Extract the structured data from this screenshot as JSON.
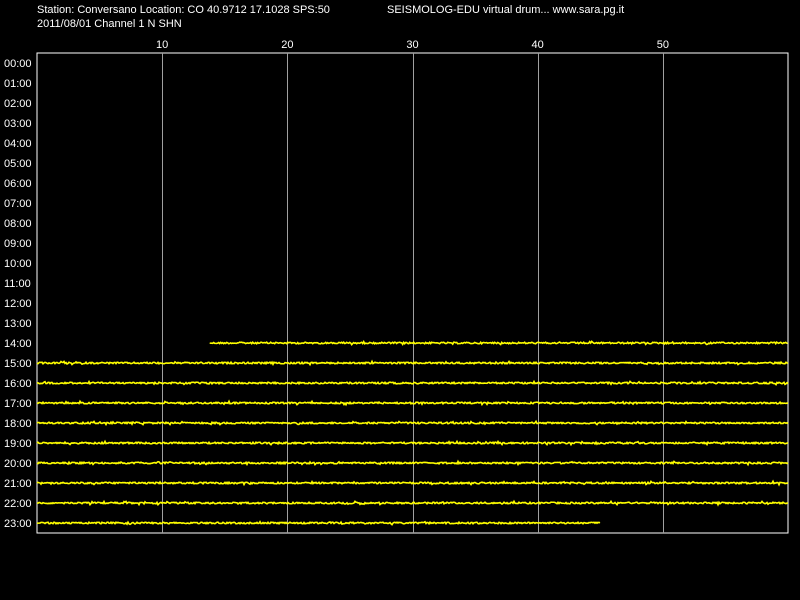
{
  "header": {
    "station_line": "Station: Conversano Location: CO 40.9712 17.1028 SPS:50",
    "date_channel_line": "2011/08/01  Channel 1 N SHN",
    "app_title": "SEISMOLOG-EDU virtual drum... www.sara.pg.it"
  },
  "colors": {
    "background": "#000000",
    "trace": "#ffff00",
    "grid": "#a0a0a0",
    "text": "#ffffff"
  },
  "chart_data": {
    "type": "line",
    "x_unit": "minutes",
    "x_range": [
      0,
      60
    ],
    "x_ticks": [
      10,
      20,
      30,
      40,
      50
    ],
    "x_tick_labels": [
      "10",
      "20",
      "30",
      "40",
      "50"
    ],
    "hour_labels": [
      "00:00",
      "01:00",
      "02:00",
      "03:00",
      "04:00",
      "05:00",
      "06:00",
      "07:00",
      "08:00",
      "09:00",
      "10:00",
      "11:00",
      "12:00",
      "13:00",
      "14:00",
      "15:00",
      "16:00",
      "17:00",
      "18:00",
      "19:00",
      "20:00",
      "21:00",
      "22:00",
      "23:00"
    ],
    "traces": [
      {
        "hour": "14:00",
        "start_min": 13.8,
        "end_min": 60
      },
      {
        "hour": "15:00",
        "start_min": 0,
        "end_min": 60
      },
      {
        "hour": "16:00",
        "start_min": 0,
        "end_min": 60
      },
      {
        "hour": "17:00",
        "start_min": 0,
        "end_min": 60
      },
      {
        "hour": "18:00",
        "start_min": 0,
        "end_min": 60
      },
      {
        "hour": "19:00",
        "start_min": 0,
        "end_min": 60
      },
      {
        "hour": "20:00",
        "start_min": 0,
        "end_min": 60
      },
      {
        "hour": "21:00",
        "start_min": 0,
        "end_min": 60
      },
      {
        "hour": "22:00",
        "start_min": 0,
        "end_min": 60
      },
      {
        "hour": "23:00",
        "start_min": 0,
        "end_min": 45
      }
    ]
  }
}
